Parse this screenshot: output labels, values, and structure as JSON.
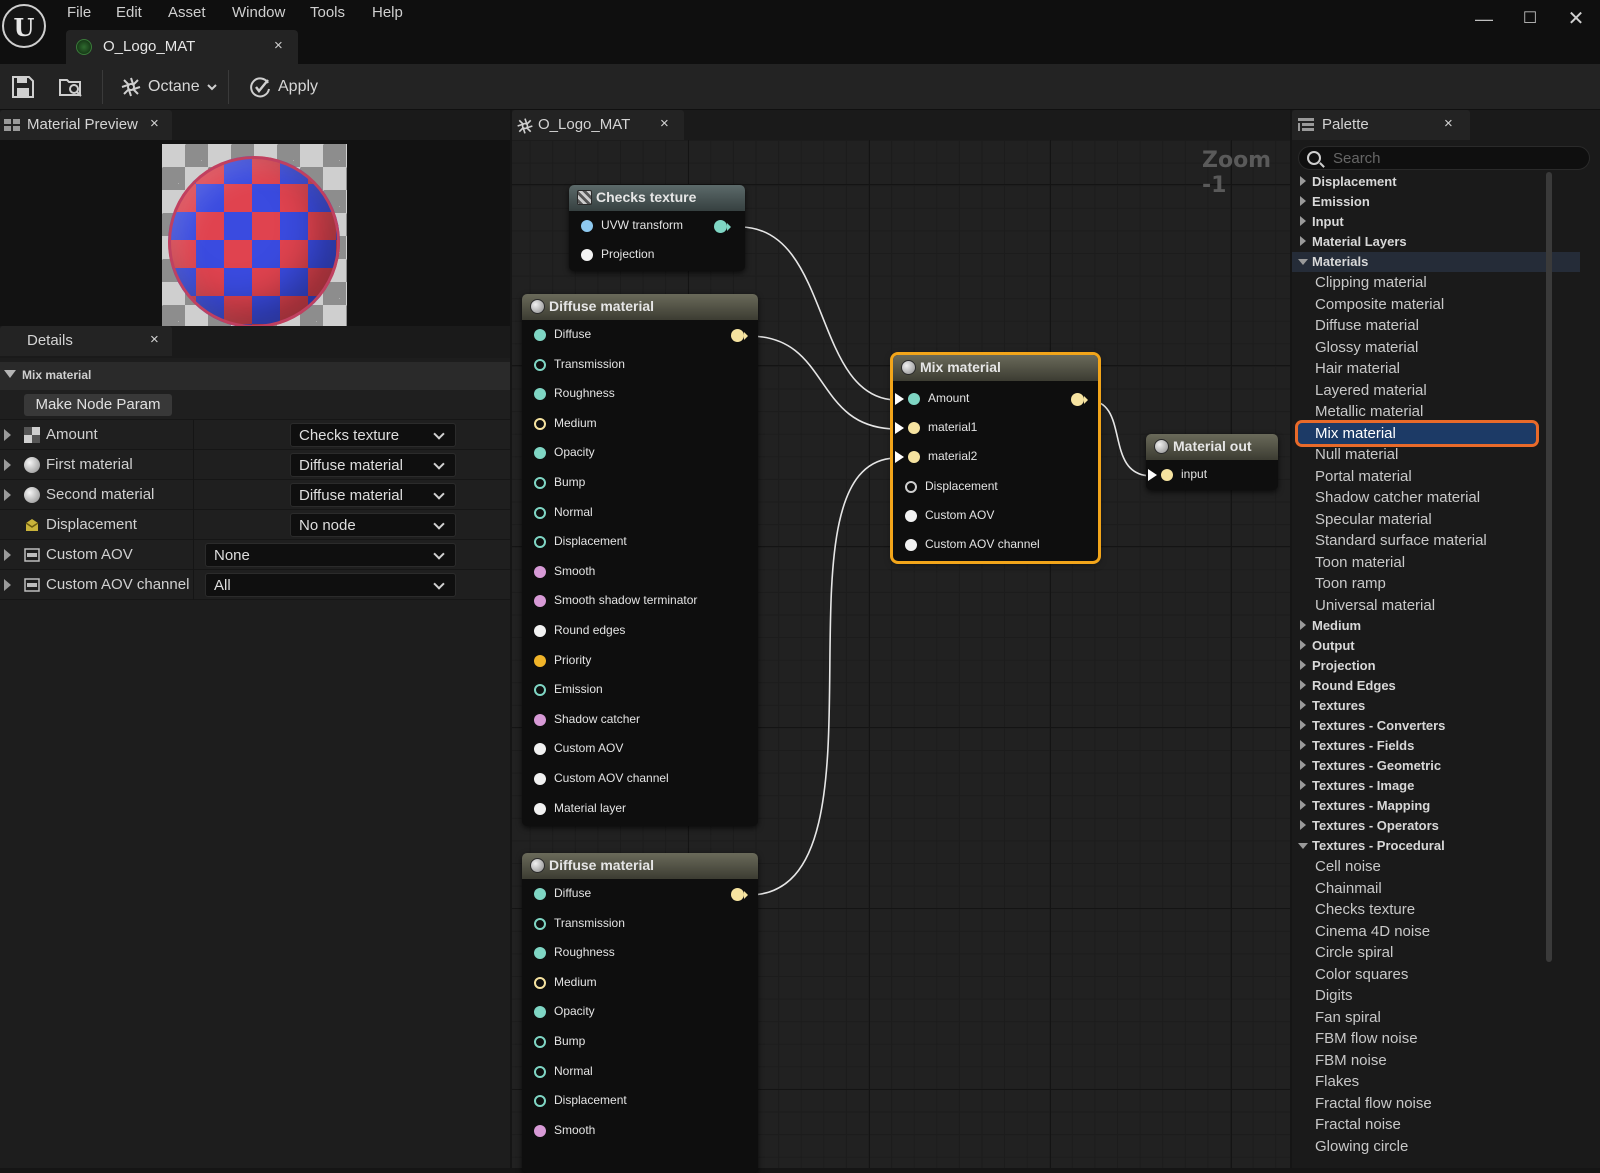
{
  "menu": [
    "File",
    "Edit",
    "Asset",
    "Window",
    "Tools",
    "Help"
  ],
  "asset_tab": {
    "label": "O_Logo_MAT",
    "close": "×"
  },
  "window_controls": {
    "minimize": "—",
    "maximize": "☐",
    "close": "✕"
  },
  "toolbar": {
    "octane_label": "Octane",
    "apply_label": "Apply"
  },
  "preview_panel": {
    "title": "Material Preview",
    "close": "×"
  },
  "details": {
    "title": "Details",
    "close": "×",
    "section": "Mix material",
    "make_node_param": "Make Node Param",
    "properties": [
      {
        "label": "Amount",
        "value": "Checks texture",
        "icon": "texture-icon"
      },
      {
        "label": "First material",
        "value": "Diffuse material",
        "icon": "sphere-icon"
      },
      {
        "label": "Second material",
        "value": "Diffuse material",
        "icon": "sphere-icon"
      },
      {
        "label": "Displacement",
        "value": "No node",
        "icon": "displacement-icon"
      },
      {
        "label": "Custom AOV",
        "value": "None",
        "icon": "aov-icon"
      },
      {
        "label": "Custom AOV channel",
        "value": "All",
        "icon": "aov-icon"
      }
    ]
  },
  "graph": {
    "tab_label": "O_Logo_MAT",
    "close": "×",
    "zoom": "Zoom -1",
    "checks_node": {
      "title": "Checks texture",
      "pins": [
        "UVW transform",
        "Projection"
      ]
    },
    "diffuse1": {
      "title": "Diffuse material",
      "pins": [
        "Diffuse",
        "Transmission",
        "Roughness",
        "Medium",
        "Opacity",
        "Bump",
        "Normal",
        "Displacement",
        "Smooth",
        "Smooth shadow terminator",
        "Round edges",
        "Priority",
        "Emission",
        "Shadow catcher",
        "Custom AOV",
        "Custom AOV channel",
        "Material layer"
      ]
    },
    "diffuse2": {
      "title": "Diffuse material",
      "pins": [
        "Diffuse",
        "Transmission",
        "Roughness",
        "Medium",
        "Opacity",
        "Bump",
        "Normal",
        "Displacement",
        "Smooth"
      ]
    },
    "mix_node": {
      "title": "Mix material",
      "pins": [
        "Amount",
        "material1",
        "material2",
        "Displacement",
        "Custom AOV",
        "Custom AOV channel"
      ]
    },
    "out_node": {
      "title": "Material out",
      "pins": [
        "input"
      ]
    },
    "pin_colors": {
      "cyan": "#7fd6c4",
      "cream": "#f6e3a0",
      "white": "#f2f2f2",
      "pink": "#d79ad6",
      "gold": "#f0b429",
      "blue": "#8ec9f0"
    }
  },
  "palette": {
    "title": "Palette",
    "close": "×",
    "search_placeholder": "Search",
    "categories_top": [
      "Displacement",
      "Emission",
      "Input",
      "Material Layers"
    ],
    "materials_category": "Materials",
    "materials": [
      "Clipping material",
      "Composite material",
      "Diffuse material",
      "Glossy material",
      "Hair material",
      "Layered material",
      "Metallic material",
      "Mix material",
      "Null material",
      "Portal material",
      "Shadow catcher material",
      "Specular material",
      "Standard surface material",
      "Toon material",
      "Toon ramp",
      "Universal material"
    ],
    "categories_mid": [
      "Medium",
      "Output",
      "Projection",
      "Round Edges",
      "Textures",
      "Textures - Converters",
      "Textures - Fields",
      "Textures - Geometric",
      "Textures - Image",
      "Textures - Mapping",
      "Textures - Operators"
    ],
    "procedural_category": "Textures - Procedural",
    "procedural": [
      "Cell noise",
      "Chainmail",
      "Checks texture",
      "Cinema 4D noise",
      "Circle spiral",
      "Color squares",
      "Digits",
      "Fan spiral",
      "FBM flow noise",
      "FBM noise",
      "Flakes",
      "Fractal flow noise",
      "Fractal noise",
      "Glowing circle"
    ],
    "highlighted": "Mix material"
  }
}
